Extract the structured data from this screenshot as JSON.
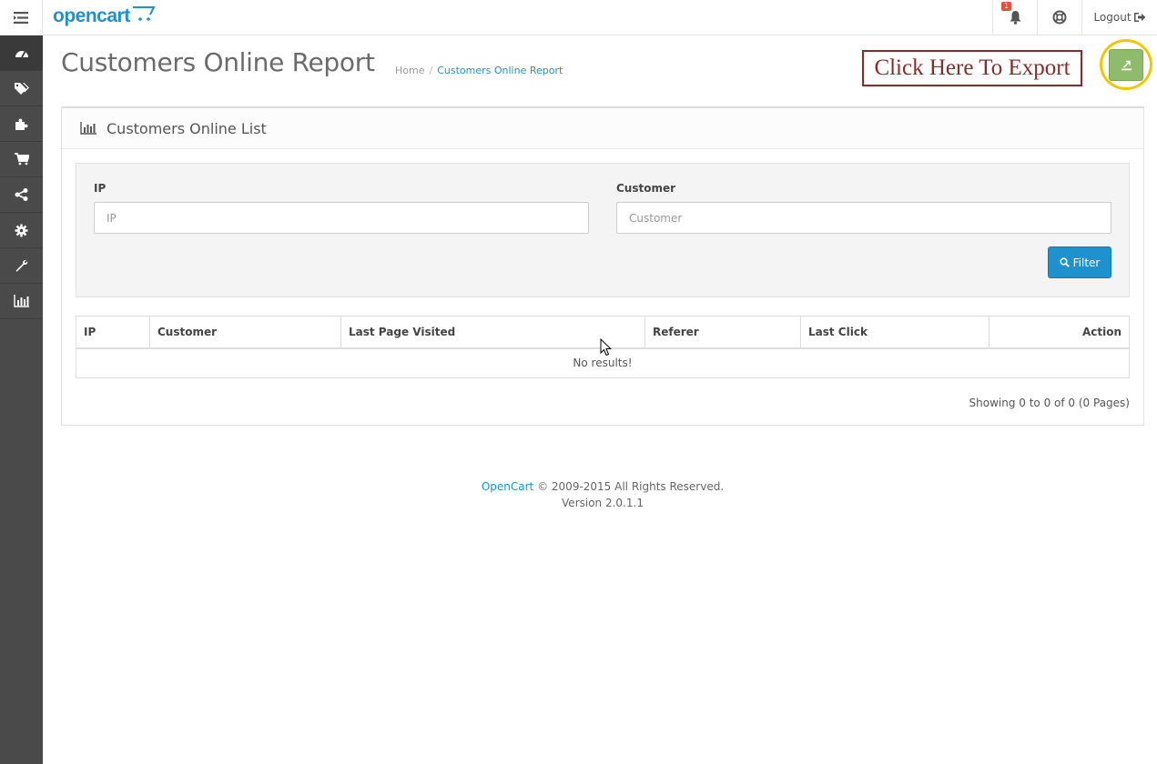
{
  "header": {
    "logo": "opencart",
    "notification_count": "1",
    "logout_label": "Logout"
  },
  "sidebar": {
    "items": [
      {
        "icon": "dashboard-icon"
      },
      {
        "icon": "tags-icon"
      },
      {
        "icon": "puzzle-icon"
      },
      {
        "icon": "shopping-cart-icon"
      },
      {
        "icon": "share-icon"
      },
      {
        "icon": "cog-icon"
      },
      {
        "icon": "wrench-icon"
      },
      {
        "icon": "bar-chart-icon"
      }
    ]
  },
  "page": {
    "title": "Customers Online Report",
    "breadcrumb": [
      "Home",
      "Customers Online Report"
    ],
    "export_callout": "Click Here To Export"
  },
  "panel": {
    "title": "Customers Online List",
    "filter": {
      "ip_label": "IP",
      "ip_placeholder": "IP",
      "customer_label": "Customer",
      "customer_placeholder": "Customer",
      "filter_button": "Filter"
    },
    "table": {
      "columns": [
        "IP",
        "Customer",
        "Last Page Visited",
        "Referer",
        "Last Click",
        "Action"
      ],
      "empty_message": "No results!"
    },
    "pagination_text": "Showing 0 to 0 of 0 (0 Pages)"
  },
  "footer": {
    "link": "OpenCart",
    "copyright": "© 2009-2015 All Rights Reserved.",
    "version": "Version 2.0.1.1"
  },
  "colors": {
    "accent": "#1e91cf",
    "sidebar": "#4a4a4a",
    "export_button": "#8fbb6c",
    "highlight_ring": "#f0c800",
    "callout": "#8b2a2a"
  }
}
